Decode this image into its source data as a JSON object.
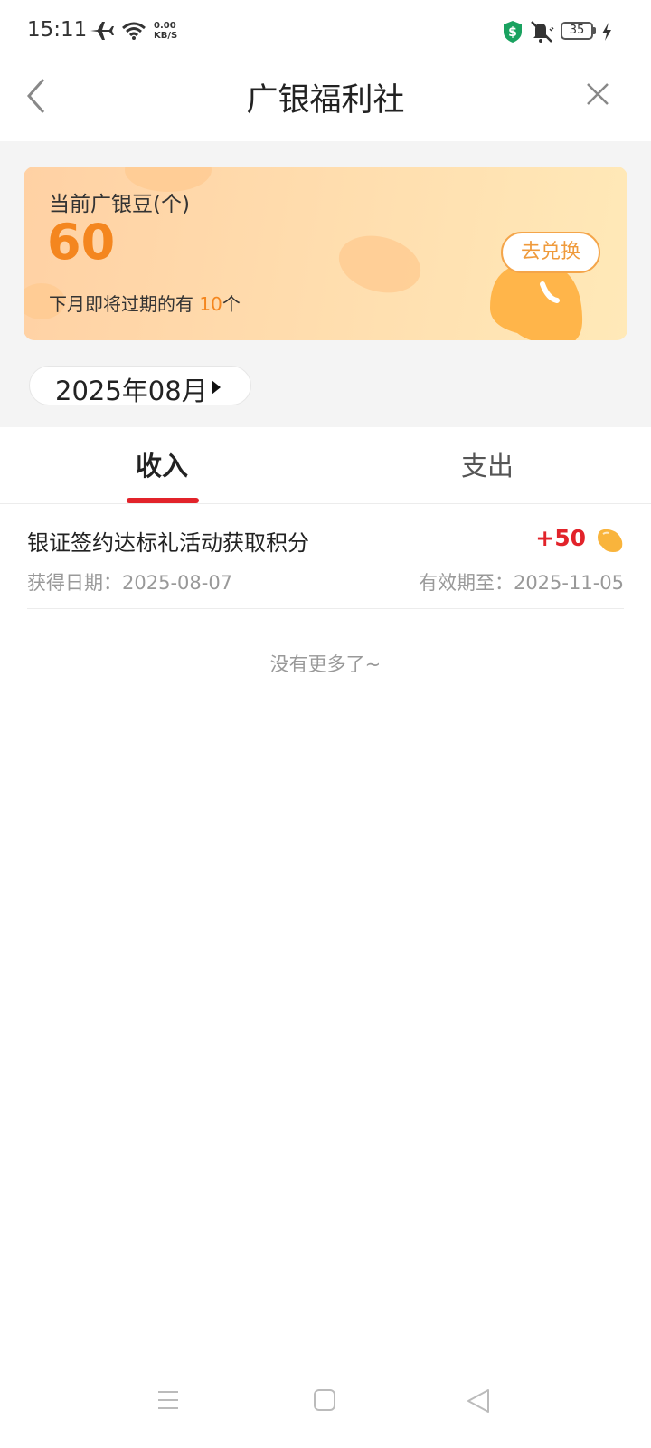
{
  "status_bar": {
    "time": "15:11",
    "net_speed_value": "0.00",
    "net_speed_unit": "KB/S",
    "battery": "35"
  },
  "header": {
    "title": "广银福利社"
  },
  "bean_card": {
    "label": "当前广银豆(个)",
    "value": "60",
    "expire_prefix": "下月即将过期的有 ",
    "expire_count": "10",
    "expire_suffix": "个",
    "redeem_label": "去兑换"
  },
  "month_selector": {
    "label": "2025年08月"
  },
  "tabs": [
    {
      "label": "收入",
      "active": true
    },
    {
      "label": "支出",
      "active": false
    }
  ],
  "records": [
    {
      "title": "银证签约达标礼活动获取积分",
      "points": "+50",
      "date": "获得日期：2025-08-07",
      "expiry": "有效期至：2025-11-05"
    }
  ],
  "footer_note": "没有更多了~",
  "colors": {
    "accent_red": "#e2232a",
    "orange": "#f4861f",
    "card_gradient_start": "#ffd1a4",
    "card_gradient_end": "#ffe9b8"
  },
  "icons": [
    "back-arrow-icon",
    "close-icon",
    "airplane-icon",
    "wifi-icon",
    "shield-dollar-icon",
    "mute-icon",
    "battery-icon",
    "charging-bolt-icon",
    "caret-right-icon",
    "bean-icon",
    "menu-icon",
    "home-icon",
    "back-triangle-icon"
  ]
}
